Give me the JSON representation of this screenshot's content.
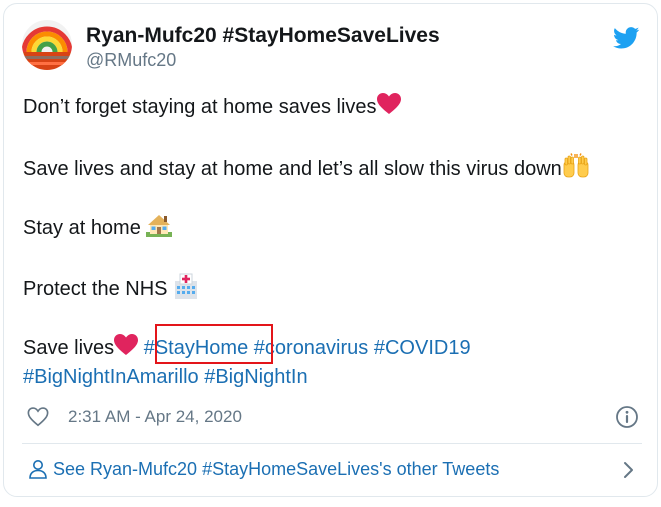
{
  "tweet": {
    "display_name": "Ryan-Mufc20 #StayHomeSaveLives",
    "handle": "@RMufc20",
    "lines": {
      "l1": "Don’t forget staying at home saves lives",
      "l2": "Save lives and stay at home and let’s all slow this virus down",
      "l3": "Stay at home ",
      "l4": "Protect the NHS ",
      "l5": "Save lives"
    },
    "hashtags": {
      "stayhome": "#StayHome",
      "coronavirus": "#coronavirus",
      "covid19": "#COVID19",
      "bignightinamarillo": "#BigNightInAmarillo",
      "bignightin": "#BigNightIn"
    },
    "emoji_names": [
      "red-heart-icon",
      "raising-hands-icon",
      "house-with-garden-icon",
      "hospital-icon",
      "red-heart-icon"
    ],
    "timestamp": "2:31 AM - Apr 24, 2020"
  },
  "footer": {
    "link_text": "See Ryan-Mufc20 #StayHomeSaveLives's other Tweets"
  },
  "icons": {
    "brand": "twitter-bird-icon",
    "like": "heart-outline-icon",
    "info": "info-icon",
    "profile": "person-icon",
    "next": "chevron-right-icon"
  },
  "colors": {
    "text": "#14171a",
    "secondary": "#657786",
    "link": "#1b6fb3",
    "twitter_blue": "#1da1f2",
    "heart_red": "#e0245e",
    "highlight_red": "#e3151a"
  }
}
